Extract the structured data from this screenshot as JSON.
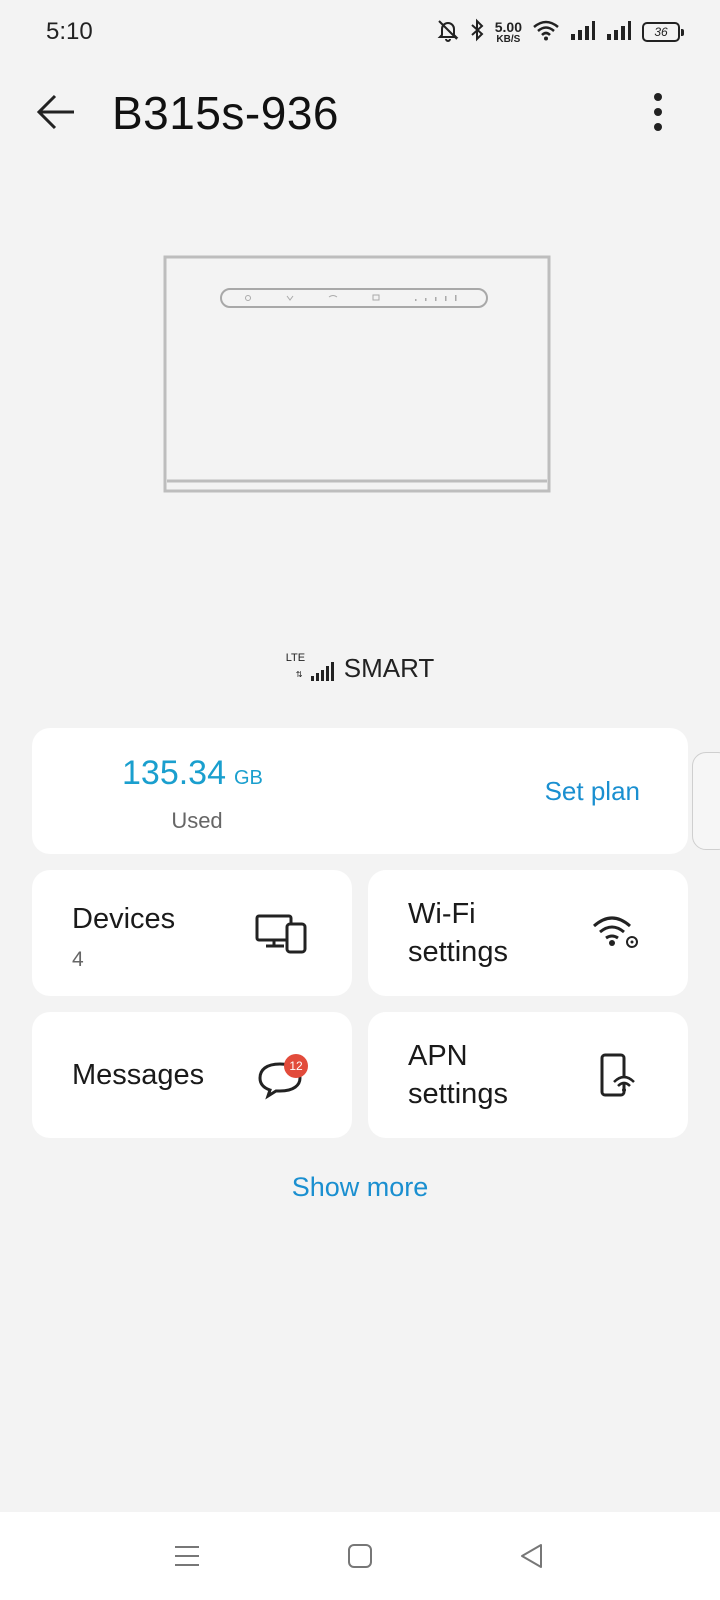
{
  "status_bar": {
    "time": "5:10",
    "net_speed_value": "5.00",
    "net_speed_unit": "KB/S",
    "battery_level": "36",
    "icons": [
      "mute-bell-icon",
      "bluetooth-icon",
      "wifi-icon",
      "signal-icon",
      "signal-icon",
      "battery-icon"
    ]
  },
  "header": {
    "title": "B315s-936",
    "back_icon": "arrow-left-icon",
    "more_icon": "more-vertical-icon"
  },
  "network": {
    "tech_label": "LTE",
    "name": "SMART"
  },
  "usage": {
    "value": "135.34",
    "unit": "GB",
    "label": "Used",
    "action": "Set plan"
  },
  "tiles": {
    "devices": {
      "label": "Devices",
      "count": "4",
      "icon": "devices-icon"
    },
    "wifi": {
      "label_line1": "Wi-Fi",
      "label_line2": "settings",
      "icon": "wifi-settings-icon"
    },
    "messages": {
      "label": "Messages",
      "badge": "12",
      "icon": "chat-bubble-icon"
    },
    "apn": {
      "label_line1": "APN",
      "label_line2": "settings",
      "icon": "phone-wifi-icon"
    }
  },
  "show_more": "Show more",
  "nav": {
    "menu_icon": "menu-icon",
    "home_icon": "home-square-icon",
    "back_icon": "back-triangle-icon"
  },
  "colors": {
    "accent": "#1a8fd0",
    "usage_value": "#1a9fce",
    "badge": "#e24b3b",
    "background": "#f3f3f3",
    "card": "#ffffff"
  }
}
